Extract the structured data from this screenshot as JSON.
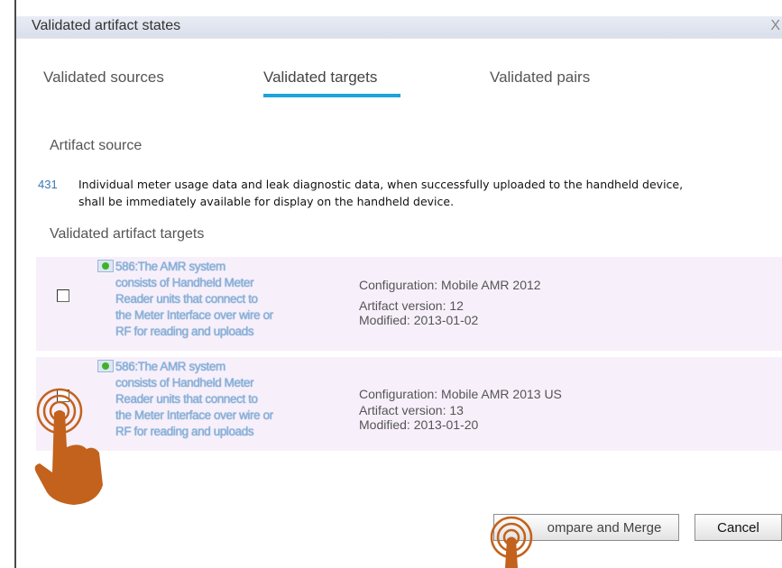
{
  "dialog": {
    "title": "Validated artifact states",
    "close_glyph": "X"
  },
  "tabs": [
    {
      "label": "Validated sources",
      "active": false
    },
    {
      "label": "Validated targets",
      "active": true
    },
    {
      "label": "Validated pairs",
      "active": false
    }
  ],
  "source": {
    "section_label": "Artifact source",
    "id": "431",
    "text_line1": "Individual meter usage data and leak diagnostic data, when successfully uploaded to the handheld device,",
    "text_line2": "shall be immediately available for display on the handheld device."
  },
  "targets": {
    "section_label": "Validated artifact targets",
    "rows": [
      {
        "checked": false,
        "link_lines": [
          "586:The AMR system",
          "consists of Handheld Meter",
          "Reader units that connect to",
          "the Meter Interface over wire or",
          "RF for reading and uploads"
        ],
        "configuration": "Configuration: Mobile AMR 2012",
        "version": "Artifact version: 12",
        "modified": "Modified: 2013-01-02"
      },
      {
        "checked": false,
        "link_lines": [
          "586:The AMR system",
          "consists of Handheld Meter",
          "Reader units that connect to",
          "the Meter Interface over wire or",
          "RF for reading and uploads"
        ],
        "configuration": "Configuration: Mobile AMR 2013 US",
        "version": "Artifact version: 13",
        "modified": "Modified: 2013-01-20"
      }
    ]
  },
  "buttons": {
    "compare": "ompare and Merge",
    "cancel": "Cancel"
  },
  "colors": {
    "tab_underline": "#1fa3dc",
    "row_background": "#f7f0fb",
    "hand_overlay": "#c2621c"
  },
  "icons": [
    "close-icon",
    "requirement-icon",
    "pointer-hand-icon"
  ]
}
